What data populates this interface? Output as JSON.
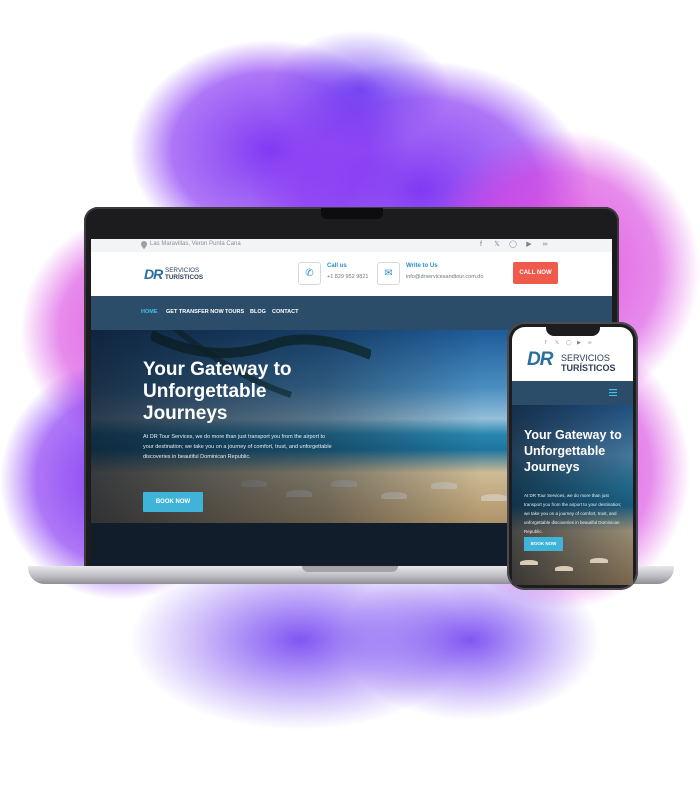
{
  "desktop": {
    "topbar": {
      "location": "Las Maravillas, Veron Punta Cana"
    },
    "logo": {
      "mark": "DR",
      "line1": "SERVICIOS",
      "line2": "TURÍSTICOS"
    },
    "contact": {
      "call_title": "Call us",
      "call_value": "+1 829 952 9821",
      "write_title": "Write to Us",
      "write_value": "info@drservicesandtour.com.do"
    },
    "call_now": "CALL NOW",
    "nav": [
      "HOME",
      "GET TRANSFER NOW",
      "TOURS",
      "BLOG",
      "CONTACT"
    ],
    "hero": {
      "title": "Your Gateway to Unforgettable Journeys",
      "text": "At DR Tour Services, we do more than just transport you from the airport to your destination; we take you on a journey of comfort, trust, and unforgettable discoveries in beautiful Dominican Republic.",
      "button": "BOOK NOW"
    }
  },
  "mobile": {
    "logo": {
      "mark": "DR",
      "line1": "SERVICIOS",
      "line2": "TURÍSTICOS"
    },
    "hero": {
      "title": "Your Gateway to Unforgettable Journeys",
      "text": "At DR Tour Services, we do more than just transport you from the airport to your destination; we take you on a journey of comfort, trust, and unforgettable discoveries in beautiful Dominican Republic.",
      "button": "BOOK NOW"
    }
  },
  "icons": {
    "social": [
      "facebook-icon",
      "x-icon",
      "whatsapp-icon",
      "youtube-icon",
      "tripadvisor-icon"
    ],
    "phone": "phone-icon",
    "mail": "mail-icon",
    "menu": "hamburger-icon"
  },
  "colors": {
    "brand_blue": "#2a8ec4",
    "nav_bg": "#2b4d69",
    "call_now_bg": "#f05a4c",
    "book_now_bg": "#3fb4d8",
    "splash_purple": "#8a3cf0",
    "splash_magenta": "#e040d8"
  }
}
